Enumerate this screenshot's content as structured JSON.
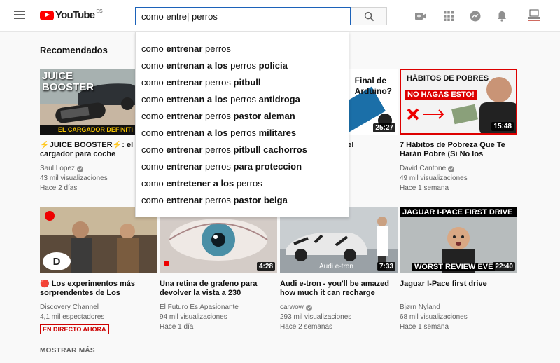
{
  "header": {
    "logo_text": "YouTube",
    "logo_region": "ES",
    "search_value": "como entre| perros"
  },
  "suggestions": [
    [
      {
        "t": "como "
      },
      {
        "t": "entrenar",
        "b": true
      },
      {
        "t": " perros"
      }
    ],
    [
      {
        "t": "como "
      },
      {
        "t": "entrenan a los",
        "b": true
      },
      {
        "t": " perros "
      },
      {
        "t": "policia",
        "b": true
      }
    ],
    [
      {
        "t": "como "
      },
      {
        "t": "entrenar",
        "b": true
      },
      {
        "t": " perros "
      },
      {
        "t": "pitbull",
        "b": true
      }
    ],
    [
      {
        "t": "como "
      },
      {
        "t": "entrenan a los",
        "b": true
      },
      {
        "t": " perros "
      },
      {
        "t": "antidroga",
        "b": true
      }
    ],
    [
      {
        "t": "como "
      },
      {
        "t": "entrenar",
        "b": true
      },
      {
        "t": " perros "
      },
      {
        "t": "pastor aleman",
        "b": true
      }
    ],
    [
      {
        "t": "como "
      },
      {
        "t": "entrenan a los",
        "b": true
      },
      {
        "t": " perros "
      },
      {
        "t": "militares",
        "b": true
      }
    ],
    [
      {
        "t": "como "
      },
      {
        "t": "entrenar",
        "b": true
      },
      {
        "t": " perros "
      },
      {
        "t": "pitbull cachorros",
        "b": true
      }
    ],
    [
      {
        "t": "como "
      },
      {
        "t": "entrenar",
        "b": true
      },
      {
        "t": " perros "
      },
      {
        "t": "para proteccion",
        "b": true
      }
    ],
    [
      {
        "t": "como "
      },
      {
        "t": "entretener a los",
        "b": true
      },
      {
        "t": " perros"
      }
    ],
    [
      {
        "t": "como "
      },
      {
        "t": "entrenar",
        "b": true
      },
      {
        "t": " perros "
      },
      {
        "t": "pastor belga",
        "b": true
      }
    ]
  ],
  "section": {
    "title": "Recomendados",
    "more": "MOSTRAR MÁS"
  },
  "videos": [
    {
      "title": "⚡JUICE BOOSTER⚡: el mejor cargador para coche",
      "channel": "Saul Lopez",
      "verified": true,
      "views": "43 mil visualizaciones",
      "age": "Hace 2 días",
      "duration": "",
      "thumb_text": [
        "JUICE",
        "BOOSTER"
      ],
      "thumb_caption": "EL CARGADOR DEFINITI"
    },
    {
      "title": "? Es el",
      "channel": "",
      "verified": false,
      "views": "",
      "age": "",
      "duration": "25:27",
      "thumb_text": [
        "Final de",
        "Arduino?"
      ]
    },
    {
      "title": "7 Hábitos de Pobreza Que Te Harán Pobre (Si No los",
      "channel": "David Cantone",
      "verified": true,
      "views": "49 mil visualizaciones",
      "age": "Hace 1 semana",
      "duration": "15:48",
      "thumb_text": [
        "HÁBITOS DE POBRES",
        "NO HAGAS ESTO!"
      ]
    },
    {
      "title": "🔴 Los experimentos más sorprendentes de Los",
      "channel": "Discovery Channel",
      "verified": false,
      "views": "4,1 mil espectadores",
      "age": "",
      "live": "EN DIRECTO AHORA",
      "duration": ""
    },
    {
      "title": "Una retina de grafeno para devolver la vista a 230",
      "channel": "El Futuro Es Apasionante",
      "verified": false,
      "views": "94 mil visualizaciones",
      "age": "Hace 1 día",
      "duration": "4:28"
    },
    {
      "title": "Audi e-tron - you'll be amazed how much it can recharge",
      "channel": "carwow",
      "verified": true,
      "views": "293 mil visualizaciones",
      "age": "Hace 2 semanas",
      "duration": "7:33",
      "thumb_caption": "Audi e-tron"
    },
    {
      "title": "Jaguar I-Pace first drive",
      "channel": "Bjørn Nyland",
      "verified": false,
      "views": "68 mil visualizaciones",
      "age": "Hace 1 semana",
      "duration": "22:40",
      "thumb_text": [
        "JAGUAR I-PACE FIRST DRIVE"
      ],
      "thumb_caption": "WORST REVIEW EVE"
    }
  ],
  "colors": {
    "brand_red": "#ff0000",
    "search_border": "#1c62b9",
    "text": "#0d0d0d",
    "meta": "#606060"
  },
  "icons": [
    "menu-icon",
    "search-icon",
    "video-camera-icon",
    "apps-grid-icon",
    "messages-icon",
    "bell-icon",
    "account-icon"
  ]
}
